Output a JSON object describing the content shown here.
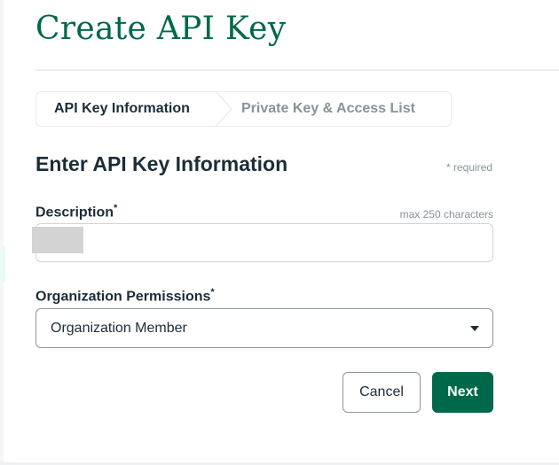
{
  "page": {
    "title": "Create API Key"
  },
  "stepper": {
    "steps": [
      {
        "label": "API Key Information",
        "active": true
      },
      {
        "label": "Private Key & Access List",
        "active": false
      }
    ]
  },
  "form": {
    "section_title": "Enter API Key Information",
    "required_note": "* required",
    "description": {
      "label": "Description",
      "required_mark": "*",
      "max_note": "max 250 characters",
      "value": ""
    },
    "org_permissions": {
      "label": "Organization Permissions",
      "required_mark": "*",
      "selected": "Organization Member"
    }
  },
  "actions": {
    "cancel_label": "Cancel",
    "next_label": "Next"
  },
  "icons": {
    "select_caret": "caret-down-icon",
    "stepper_separator": "chevron-right-icon"
  },
  "colors": {
    "brand_green": "#00684a",
    "text_dark": "#1c2d38",
    "text_muted": "#889397",
    "border": "#8c969b"
  }
}
